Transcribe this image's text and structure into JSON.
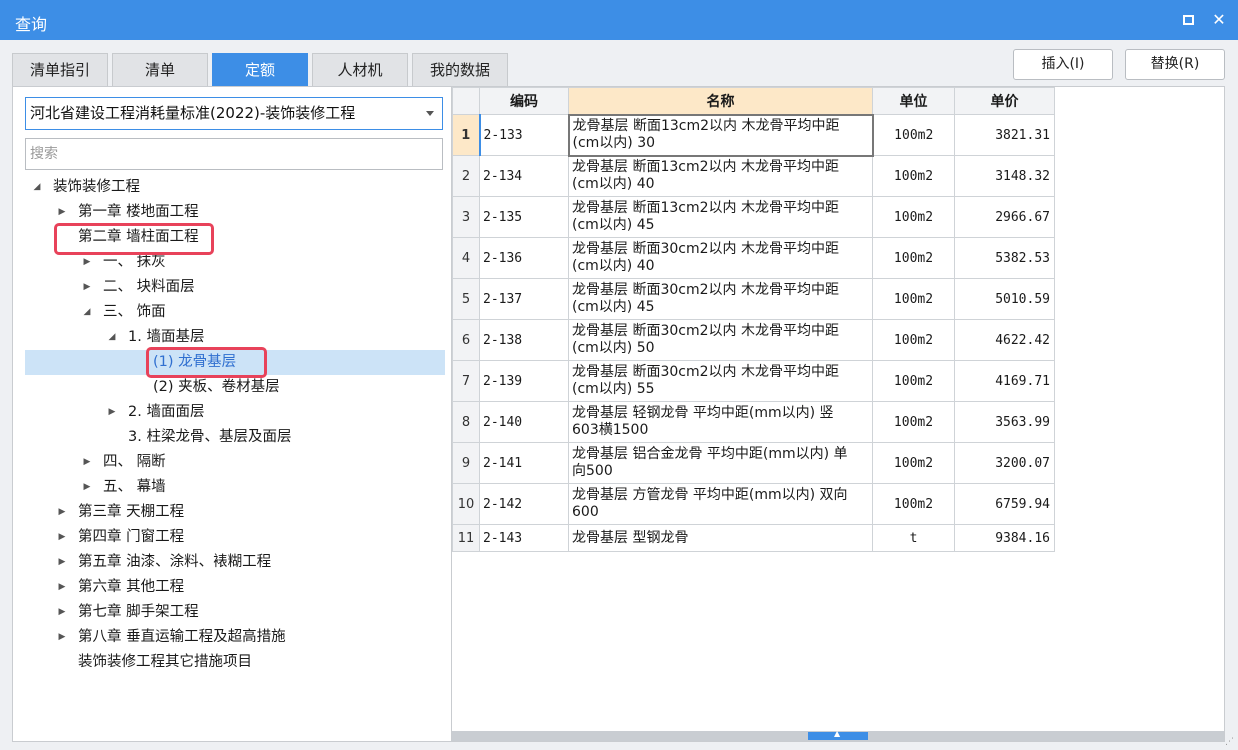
{
  "window": {
    "title": "查询",
    "maximize_icon": "maximize-icon",
    "close_glyph": "✕"
  },
  "tabs": [
    "清单指引",
    "清单",
    "定额",
    "人材机",
    "我的数据"
  ],
  "active_tab": "定额",
  "actions": {
    "insert_label": "插入(I)",
    "replace_label": "替换(R)"
  },
  "selector": {
    "value": "河北省建设工程消耗量标准(2022)-装饰装修工程"
  },
  "search": {
    "placeholder": "搜索"
  },
  "tree": [
    {
      "label": "装饰装修工程",
      "arrow": "◢",
      "expanded": true
    },
    {
      "label": "第一章 楼地面工程",
      "arrow": "▶"
    },
    {
      "label": "第二章 墙柱面工程",
      "arrow": "",
      "highlighted": true
    },
    {
      "label": "一、 抹灰",
      "arrow": "▶"
    },
    {
      "label": "二、 块料面层",
      "arrow": "▶"
    },
    {
      "label": "三、 饰面",
      "arrow": "◢"
    },
    {
      "label": "1. 墙面基层",
      "arrow": "◢"
    },
    {
      "label": "(1) 龙骨基层",
      "arrow": "",
      "selected": true
    },
    {
      "label": "(2) 夹板、卷材基层",
      "arrow": ""
    },
    {
      "label": "2. 墙面面层",
      "arrow": "▶"
    },
    {
      "label": "3. 柱梁龙骨、基层及面层",
      "arrow": ""
    },
    {
      "label": "四、 隔断",
      "arrow": "▶"
    },
    {
      "label": "五、 幕墙",
      "arrow": "▶"
    },
    {
      "label": "第三章 天棚工程",
      "arrow": "▶"
    },
    {
      "label": "第四章 门窗工程",
      "arrow": "▶"
    },
    {
      "label": "第五章 油漆、涂料、裱糊工程",
      "arrow": "▶"
    },
    {
      "label": "第六章 其他工程",
      "arrow": "▶"
    },
    {
      "label": "第七章 脚手架工程",
      "arrow": "▶"
    },
    {
      "label": "第八章 垂直运输工程及超高措施",
      "arrow": "▶"
    },
    {
      "label": "装饰装修工程其它措施项目",
      "arrow": ""
    }
  ],
  "table": {
    "headers": {
      "code": "编码",
      "name": "名称",
      "unit": "单位",
      "price": "单价"
    },
    "rows": [
      {
        "idx": "1",
        "code": "2-133",
        "name1": "龙骨基层 断面13cm2以内 木龙骨平均中距",
        "name2": "(cm以内) 30",
        "unit": "100m2",
        "price": "3821.31"
      },
      {
        "idx": "2",
        "code": "2-134",
        "name1": "龙骨基层 断面13cm2以内 木龙骨平均中距",
        "name2": "(cm以内) 40",
        "unit": "100m2",
        "price": "3148.32"
      },
      {
        "idx": "3",
        "code": "2-135",
        "name1": "龙骨基层 断面13cm2以内 木龙骨平均中距",
        "name2": "(cm以内) 45",
        "unit": "100m2",
        "price": "2966.67"
      },
      {
        "idx": "4",
        "code": "2-136",
        "name1": "龙骨基层 断面30cm2以内 木龙骨平均中距",
        "name2": "(cm以内) 40",
        "unit": "100m2",
        "price": "5382.53"
      },
      {
        "idx": "5",
        "code": "2-137",
        "name1": "龙骨基层 断面30cm2以内 木龙骨平均中距",
        "name2": "(cm以内) 45",
        "unit": "100m2",
        "price": "5010.59"
      },
      {
        "idx": "6",
        "code": "2-138",
        "name1": "龙骨基层 断面30cm2以内 木龙骨平均中距",
        "name2": "(cm以内) 50",
        "unit": "100m2",
        "price": "4622.42"
      },
      {
        "idx": "7",
        "code": "2-139",
        "name1": "龙骨基层 断面30cm2以内 木龙骨平均中距",
        "name2": "(cm以内) 55",
        "unit": "100m2",
        "price": "4169.71"
      },
      {
        "idx": "8",
        "code": "2-140",
        "name1": "龙骨基层 轻钢龙骨 平均中距(mm以内) 竖",
        "name2": "603横1500",
        "unit": "100m2",
        "price": "3563.99"
      },
      {
        "idx": "9",
        "code": "2-141",
        "name1": "龙骨基层 铝合金龙骨 平均中距(mm以内) 单",
        "name2": "向500",
        "unit": "100m2",
        "price": "3200.07"
      },
      {
        "idx": "10",
        "code": "2-142",
        "name1": "龙骨基层 方管龙骨 平均中距(mm以内) 双向",
        "name2": "600",
        "unit": "100m2",
        "price": "6759.94"
      },
      {
        "idx": "11",
        "code": "2-143",
        "name1": "龙骨基层 型钢龙骨",
        "name2": "",
        "unit": "t",
        "price": "9384.16"
      }
    ]
  },
  "colors": {
    "accent": "#3d8ee6",
    "highlight": "#e8425a",
    "selected_bg": "#cce3f7",
    "header_name_bg": "#fde8c8"
  }
}
